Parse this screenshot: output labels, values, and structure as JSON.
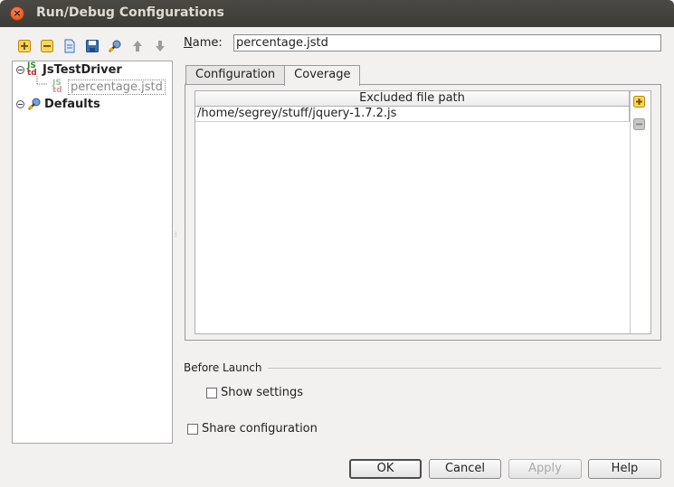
{
  "window": {
    "title": "Run/Debug Configurations"
  },
  "toolbar": {
    "icons": [
      "add-icon",
      "remove-icon",
      "copy-icon",
      "save-icon",
      "edit-defaults-icon",
      "move-up-icon",
      "move-down-icon"
    ]
  },
  "tree": {
    "group_label": "JsTestDriver",
    "group_icon_text": "JS\ntd",
    "item_label": "percentage.jstd",
    "defaults_label": "Defaults"
  },
  "name_field": {
    "label": "Name:",
    "value": "percentage.jstd"
  },
  "tabs": [
    {
      "label": "Configuration"
    },
    {
      "label": "Coverage"
    }
  ],
  "coverage": {
    "column_header": "Excluded file path",
    "rows": [
      "/home/segrey/stuff/jquery-1.7.2.js"
    ]
  },
  "before_launch": {
    "label": "Before Launch",
    "show_settings_label": "Show settings"
  },
  "share_configuration_label": "Share configuration",
  "buttons": {
    "ok": "OK",
    "cancel": "Cancel",
    "apply": "Apply",
    "help": "Help"
  },
  "colors": {
    "accent_close": "#df4a16",
    "title_bar": "#3c3b37",
    "icon_yellow": "#e8b400",
    "icon_blue": "#3b6fb6"
  }
}
